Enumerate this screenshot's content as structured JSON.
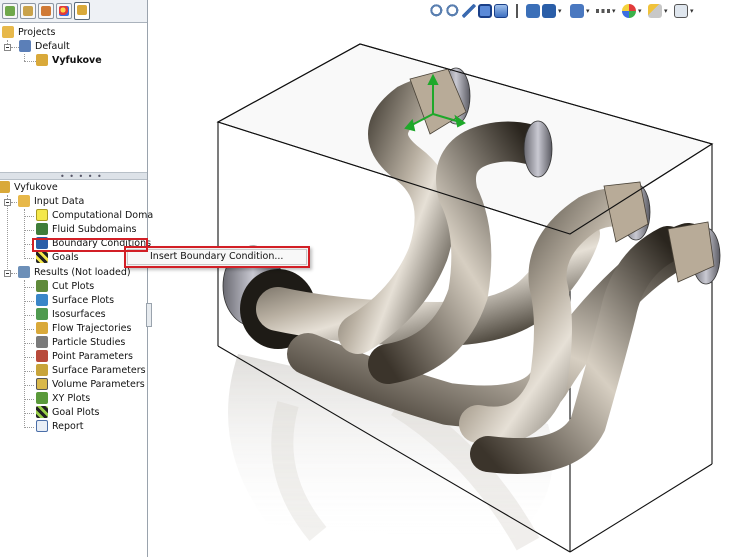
{
  "left_panel": {
    "tabs": [
      {
        "icon": "feature-manager-icon",
        "active": false
      },
      {
        "icon": "property-manager-icon",
        "active": false
      },
      {
        "icon": "configuration-manager-icon",
        "active": false
      },
      {
        "icon": "appearance-manager-icon",
        "active": false
      },
      {
        "icon": "flow-simulation-icon",
        "active": true
      }
    ],
    "projects_tree": {
      "root": "Projects",
      "config": "Default",
      "project": "Vyfukove"
    },
    "analysis_tree": {
      "root": "Vyfukove",
      "input_data": {
        "label": "Input Data",
        "items": [
          "Computational Doma",
          "Fluid Subdomains",
          "Boundary Conditions",
          "Goals"
        ]
      },
      "results": {
        "label": "Results (Not loaded)",
        "items": [
          "Cut Plots",
          "Surface Plots",
          "Isosurfaces",
          "Flow Trajectories",
          "Particle Studies",
          "Point Parameters",
          "Surface Parameters",
          "Volume Parameters",
          "XY Plots",
          "Goal Plots",
          "Report"
        ]
      }
    }
  },
  "context_menu": {
    "item": "Insert Boundary Condition..."
  },
  "toolbar": {
    "icons": [
      "zoom-to-fit-icon",
      "zoom-to-area-icon",
      "previous-view-icon",
      "section-view-icon",
      "view-orientation-icon",
      "display-style-icon",
      "hide-show-items-icon",
      "edit-appearance-icon",
      "apply-scene-icon",
      "view-settings-icon"
    ]
  },
  "colors": {
    "highlight": "#d21f26",
    "folder": "#e7b84a",
    "accent": "#2a5ea8"
  }
}
